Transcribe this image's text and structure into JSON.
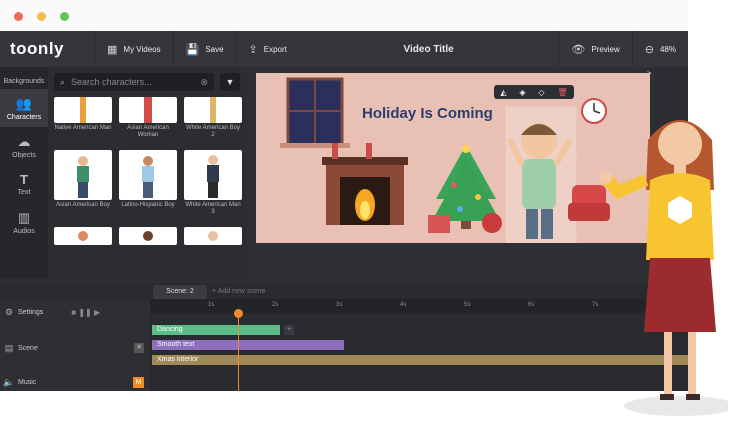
{
  "topbar": {
    "logo": "toonly",
    "my_videos": "My Videos",
    "save": "Save",
    "export": "Export",
    "title": "Video Title",
    "preview": "Preview",
    "zoom": "48%"
  },
  "sidebar": {
    "items": [
      {
        "label": "Backgrounds"
      },
      {
        "label": "Characters"
      },
      {
        "label": "Objects"
      },
      {
        "label": "Text"
      },
      {
        "label": "Audios"
      }
    ]
  },
  "search": {
    "placeholder": "Search characters..."
  },
  "characters": [
    {
      "name": "Native American Man"
    },
    {
      "name": "Asian American Woman"
    },
    {
      "name": "White American Boy 2"
    },
    {
      "name": "Asian American Boy"
    },
    {
      "name": "Latino-Hispanic Boy"
    },
    {
      "name": "White American Man 3"
    }
  ],
  "stage": {
    "text": "Holiday Is Coming"
  },
  "timeline": {
    "scene_tab": "Scene: 2",
    "add_scene": "Add new scene",
    "settings": "Settings",
    "scene": "Scene",
    "music": "Music",
    "music_badge": "M",
    "ticks": [
      "1s",
      "2s",
      "3s",
      "4s",
      "5s",
      "6s",
      "7s"
    ],
    "bars": [
      {
        "label": "Dancing",
        "color": "#5dbb8a"
      },
      {
        "label": "Smooth text",
        "color": "#8e6fbd"
      },
      {
        "label": "Xmas interior",
        "color": "#a08a5a"
      }
    ]
  },
  "colors": {
    "accent": "#f08a24",
    "dot_red": "#ee6a5f",
    "dot_yellow": "#f5bd4f",
    "dot_green": "#61c454"
  }
}
